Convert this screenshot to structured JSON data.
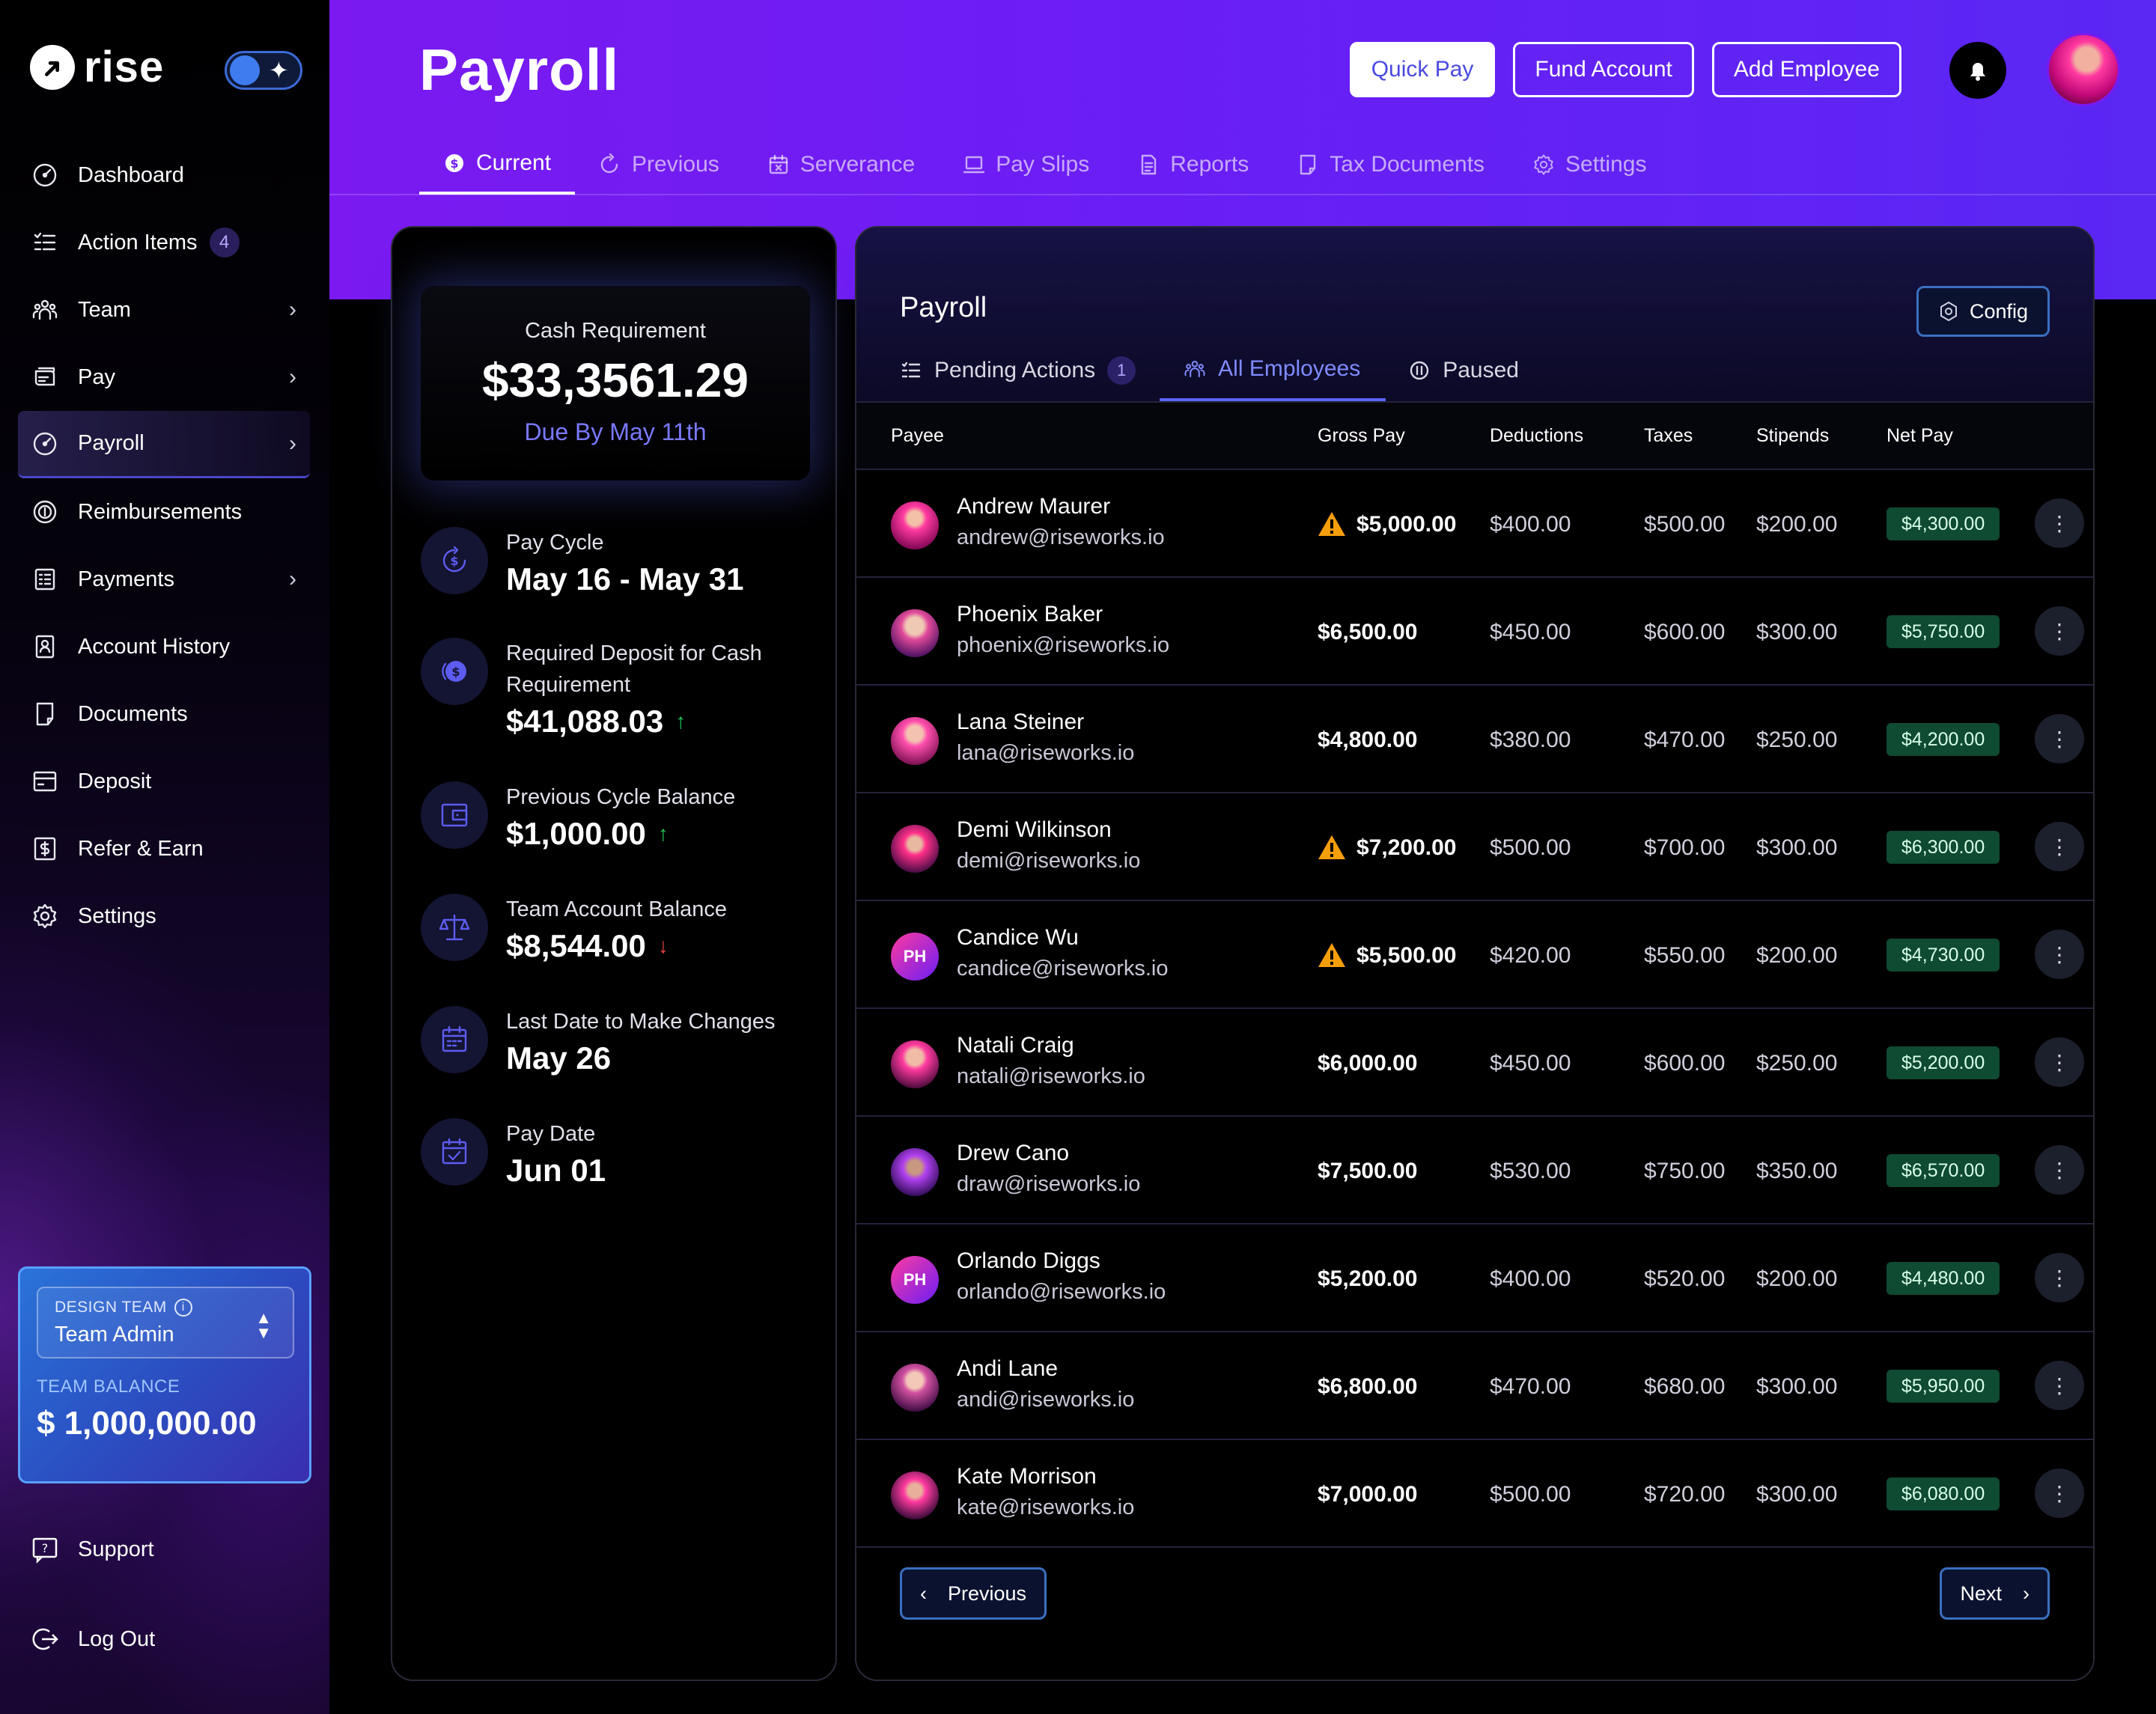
{
  "brand": {
    "name": "rise"
  },
  "sidebar": {
    "items": [
      {
        "label": "Dashboard",
        "icon": "dashboard-icon"
      },
      {
        "label": "Action Items",
        "icon": "action-items-icon",
        "badge": "4"
      },
      {
        "label": "Team",
        "icon": "team-icon",
        "chevron": true
      },
      {
        "label": "Pay",
        "icon": "pay-icon",
        "chevron": true
      },
      {
        "label": "Payroll",
        "icon": "payroll-icon",
        "chevron": true,
        "active": true
      },
      {
        "label": "Reimbursements",
        "icon": "reimbursements-icon"
      },
      {
        "label": "Payments",
        "icon": "payments-icon",
        "chevron": true
      },
      {
        "label": "Account History",
        "icon": "account-history-icon"
      },
      {
        "label": "Documents",
        "icon": "documents-icon"
      },
      {
        "label": "Deposit",
        "icon": "deposit-icon"
      },
      {
        "label": "Refer & Earn",
        "icon": "refer-earn-icon"
      },
      {
        "label": "Settings",
        "icon": "settings-icon"
      }
    ],
    "team": {
      "label": "DESIGN TEAM",
      "role": "Team Admin",
      "balance_label": "TEAM BALANCE",
      "balance": "$ 1,000,000.00"
    },
    "support": "Support",
    "logout": "Log Out"
  },
  "header": {
    "title": "Payroll",
    "buttons": {
      "quick_pay": "Quick Pay",
      "fund_account": "Fund Account",
      "add_employee": "Add Employee"
    },
    "tabs": [
      "Current",
      "Previous",
      "Serverance",
      "Pay Slips",
      "Reports",
      "Tax Documents",
      "Settings"
    ]
  },
  "summary": {
    "cash_requirement_label": "Cash Requirement",
    "cash_requirement": "$33,3561.29",
    "due": "Due By May 11th",
    "stats": [
      {
        "label": "Pay Cycle",
        "value": "May 16 - May 31"
      },
      {
        "label": "Required Deposit for Cash Requirement",
        "value": "$41,088.03",
        "trend": "up"
      },
      {
        "label": "Previous Cycle Balance",
        "value": "$1,000.00",
        "trend": "up"
      },
      {
        "label": "Team Account Balance",
        "value": "$8,544.00",
        "trend": "down"
      },
      {
        "label": "Last Date to Make Changes",
        "value": "May 26"
      },
      {
        "label": "Pay Date",
        "value": "Jun 01"
      }
    ]
  },
  "payroll": {
    "title": "Payroll",
    "config": "Config",
    "subtabs": [
      {
        "label": "Pending Actions",
        "count": "1"
      },
      {
        "label": "All Employees",
        "active": true
      },
      {
        "label": "Paused"
      }
    ],
    "columns": [
      "Payee",
      "Gross Pay",
      "Deductions",
      "Taxes",
      "Stipends",
      "Net Pay"
    ],
    "rows": [
      {
        "name": "Andrew Maurer",
        "email": "andrew@riseworks.io",
        "gross": "$5,000.00",
        "warning": true,
        "deductions": "$400.00",
        "taxes": "$500.00",
        "stipends": "$200.00",
        "net": "$4,300.00"
      },
      {
        "name": "Phoenix Baker",
        "email": "phoenix@riseworks.io",
        "gross": "$6,500.00",
        "warning": false,
        "deductions": "$450.00",
        "taxes": "$600.00",
        "stipends": "$300.00",
        "net": "$5,750.00"
      },
      {
        "name": "Lana Steiner",
        "email": "lana@riseworks.io",
        "gross": "$4,800.00",
        "warning": false,
        "deductions": "$380.00",
        "taxes": "$470.00",
        "stipends": "$250.00",
        "net": "$4,200.00"
      },
      {
        "name": "Demi Wilkinson",
        "email": "demi@riseworks.io",
        "gross": "$7,200.00",
        "warning": true,
        "deductions": "$500.00",
        "taxes": "$700.00",
        "stipends": "$300.00",
        "net": "$6,300.00"
      },
      {
        "name": "Candice Wu",
        "email": "candice@riseworks.io",
        "gross": "$5,500.00",
        "warning": true,
        "deductions": "$420.00",
        "taxes": "$550.00",
        "stipends": "$200.00",
        "net": "$4,730.00",
        "initials": "PH"
      },
      {
        "name": "Natali Craig",
        "email": "natali@riseworks.io",
        "gross": "$6,000.00",
        "warning": false,
        "deductions": "$450.00",
        "taxes": "$600.00",
        "stipends": "$250.00",
        "net": "$5,200.00"
      },
      {
        "name": "Drew Cano",
        "email": "draw@riseworks.io",
        "gross": "$7,500.00",
        "warning": false,
        "deductions": "$530.00",
        "taxes": "$750.00",
        "stipends": "$350.00",
        "net": "$6,570.00"
      },
      {
        "name": "Orlando Diggs",
        "email": "orlando@riseworks.io",
        "gross": "$5,200.00",
        "warning": false,
        "deductions": "$400.00",
        "taxes": "$520.00",
        "stipends": "$200.00",
        "net": "$4,480.00",
        "initials": "PH"
      },
      {
        "name": "Andi Lane",
        "email": "andi@riseworks.io",
        "gross": "$6,800.00",
        "warning": false,
        "deductions": "$470.00",
        "taxes": "$680.00",
        "stipends": "$300.00",
        "net": "$5,950.00"
      },
      {
        "name": "Kate Morrison",
        "email": "kate@riseworks.io",
        "gross": "$7,000.00",
        "warning": false,
        "deductions": "$500.00",
        "taxes": "$720.00",
        "stipends": "$300.00",
        "net": "$6,080.00"
      }
    ],
    "pager": {
      "previous": "Previous",
      "next": "Next"
    }
  },
  "colors": {
    "accent": "#6a1ef5",
    "link": "#7b79ff",
    "net_bg": "#0f4a32",
    "warning": "#f59e0b"
  }
}
